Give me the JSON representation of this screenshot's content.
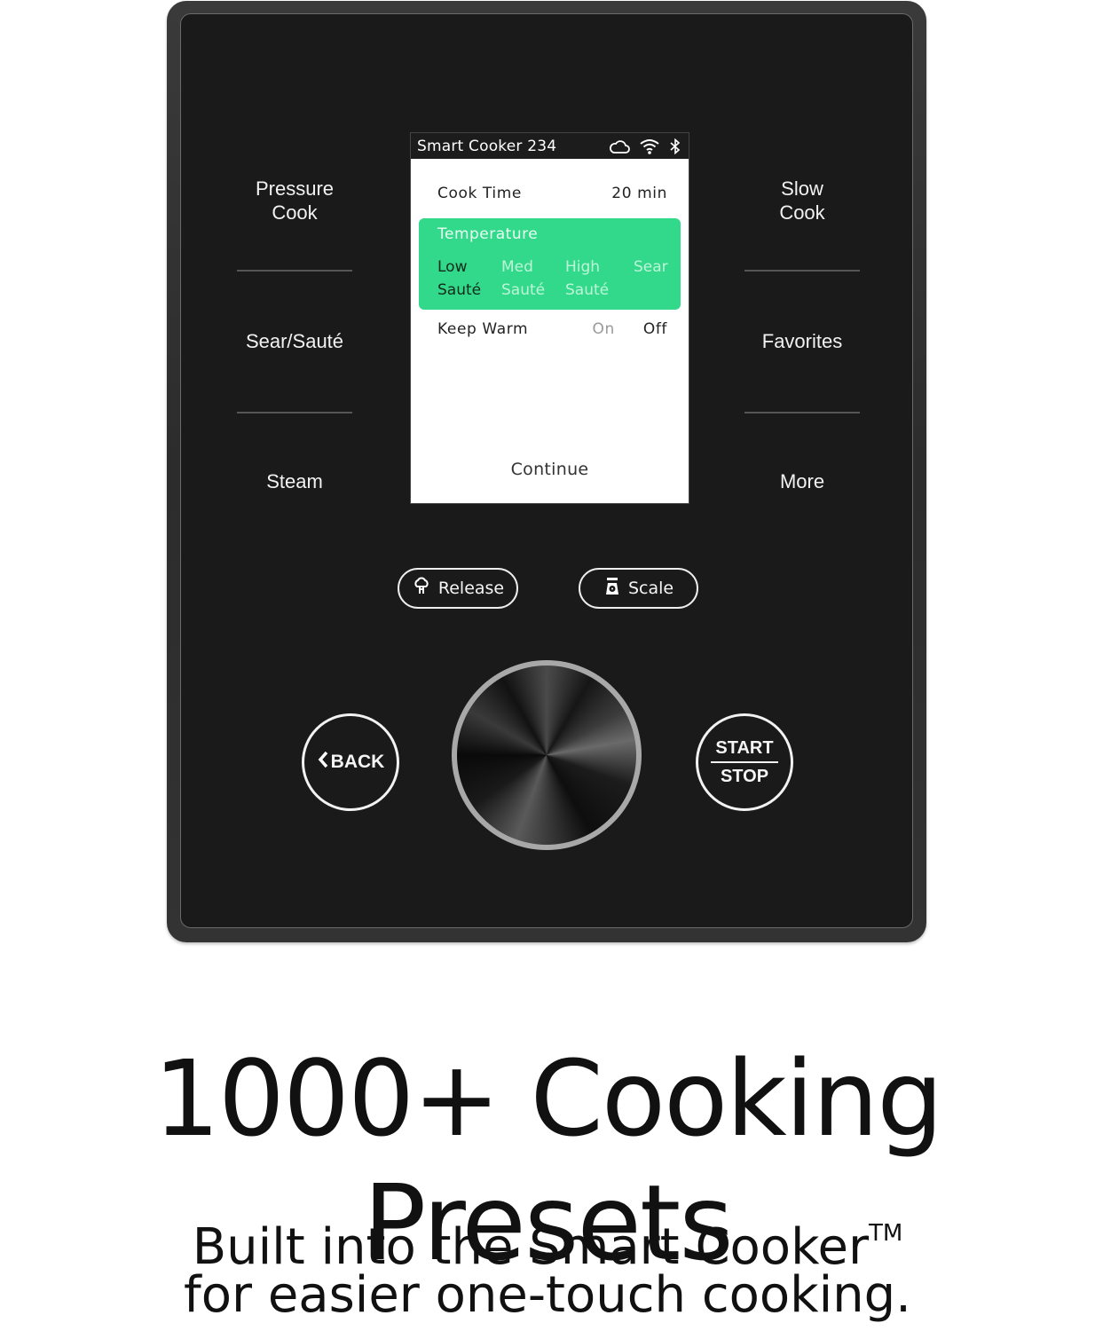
{
  "device": {
    "left_buttons": [
      {
        "label_line1": "Pressure",
        "label_line2": "Cook"
      },
      {
        "label_line1": "Sear/Sauté",
        "label_line2": ""
      },
      {
        "label_line1": "Steam",
        "label_line2": ""
      }
    ],
    "right_buttons": [
      {
        "label_line1": "Slow",
        "label_line2": "Cook"
      },
      {
        "label_line1": "Favorites",
        "label_line2": ""
      },
      {
        "label_line1": "More",
        "label_line2": ""
      }
    ],
    "screen": {
      "title": "Smart Cooker 234",
      "status_icons": [
        "cloud-icon",
        "wifi-icon",
        "bluetooth-icon"
      ],
      "cook_time": {
        "label": "Cook Time",
        "value": "20 min"
      },
      "temperature": {
        "label": "Temperature",
        "highlight_color": "#33d98a",
        "options": [
          {
            "line1": "Low",
            "line2": "Sauté",
            "selected": true
          },
          {
            "line1": "Med",
            "line2": "Sauté",
            "selected": false
          },
          {
            "line1": "High",
            "line2": "Sauté",
            "selected": false
          },
          {
            "line1": "Sear",
            "line2": "",
            "selected": false
          }
        ]
      },
      "keep_warm": {
        "label": "Keep Warm",
        "on_label": "On",
        "off_label": "Off",
        "selected": "Off"
      },
      "continue_label": "Continue"
    },
    "release_button": {
      "label": "Release",
      "icon": "steam-release-icon"
    },
    "scale_button": {
      "label": "Scale",
      "icon": "scale-icon"
    },
    "back_button": {
      "label": "BACK",
      "icon": "chevron-left-icon"
    },
    "start_stop_button": {
      "top_label": "START",
      "bottom_label": "STOP"
    },
    "dial": {
      "icon": "control-dial"
    }
  },
  "marketing": {
    "headline": "1000+ Cooking Presets",
    "subline1": "Built into the Smart Cooker",
    "trademark": "TM",
    "subline2": "for easier one-touch cooking."
  }
}
